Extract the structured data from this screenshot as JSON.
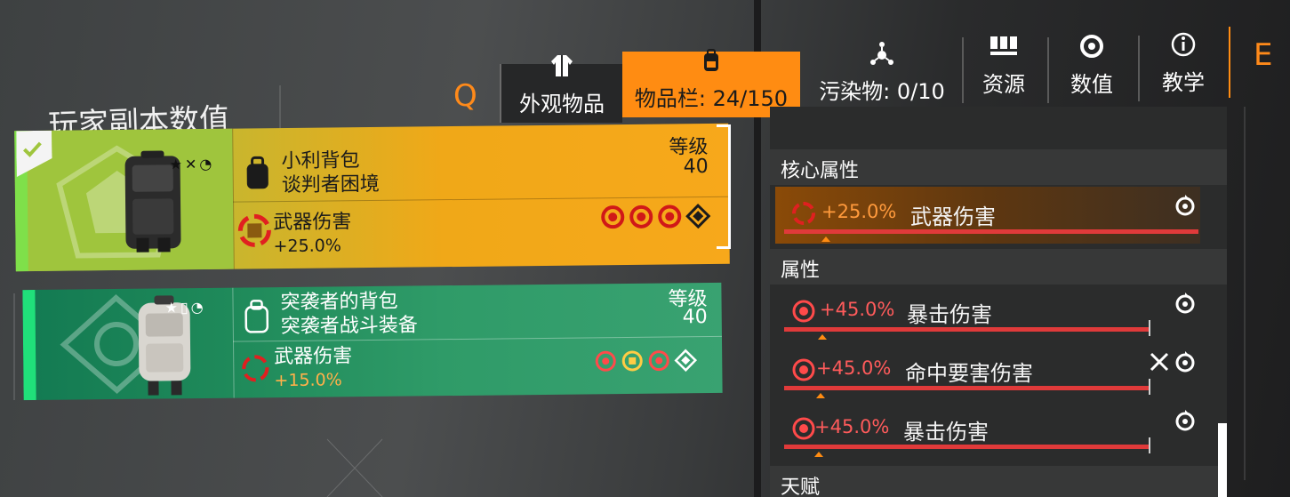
{
  "hotkeys": {
    "prev": "Q",
    "next": "E"
  },
  "tabs": [
    {
      "label": "外观物品",
      "icon": "jacket-icon"
    },
    {
      "label": "物品栏: 24/150",
      "icon": "backpack-icon",
      "active": true
    },
    {
      "label": "污染物: 0/10",
      "icon": "contamination-icon"
    },
    {
      "label": "资源",
      "icon": "resources-icon"
    },
    {
      "label": "数值",
      "icon": "target-icon"
    },
    {
      "label": "教学",
      "icon": "info-icon"
    }
  ],
  "page_title": "玩家副本数值",
  "items": [
    {
      "name": "小利背包",
      "brand": "谈判者困境",
      "level_label": "等级",
      "level": "40",
      "attribute": "武器伤害",
      "attribute_value": "+25.0%",
      "equipped": true,
      "rarity_color": "#f7a81b"
    },
    {
      "name": "突袭者的背包",
      "brand": "突袭者战斗装备",
      "level_label": "等级",
      "level": "40",
      "attribute": "武器伤害",
      "attribute_value": "+15.0%",
      "equipped": false,
      "rarity_color": "#2f9b68"
    }
  ],
  "panel": {
    "core_header": "核心属性",
    "attr_header": "属性",
    "talent_header": "天赋",
    "core_rows": [
      {
        "value": "+25.0%",
        "name": "武器伤害",
        "fill": 1.0
      }
    ],
    "attr_rows": [
      {
        "value": "+45.0%",
        "name": "暴击伤害",
        "fill": 0.88
      },
      {
        "value": "+45.0%",
        "name": "命中要害伤害",
        "fill": 0.88
      },
      {
        "value": "+45.0%",
        "name": "暴击伤害",
        "fill": 0.88
      }
    ]
  },
  "colors": {
    "accent": "#ff8c12",
    "damage": "#e03a3a",
    "crit": "#ff5b5b"
  }
}
